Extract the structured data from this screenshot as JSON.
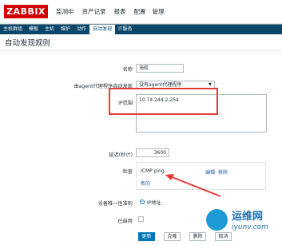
{
  "header": {
    "logo": "ZABBIX",
    "main_menu": [
      "监测中",
      "资产记录",
      "报表",
      "配置",
      "管理"
    ]
  },
  "sub_menu": [
    "主机群组",
    "模板",
    "主机",
    "维护",
    "动作",
    "自动发现",
    "IT服务"
  ],
  "page": {
    "title": "自动发现规则"
  },
  "form": {
    "name_label": "名称",
    "name_value": "海航",
    "proxy_label": "由agent代理程序自动发现",
    "proxy_value": "没有agent代理程序",
    "ip_range_label": "IP范围",
    "ip_range_value": "10.74.244.2-254",
    "delay_label": "延迟(秒计)",
    "delay_value": "3600",
    "checks_label": "检查",
    "check_type": "ICMP ping",
    "check_edit": "编辑",
    "check_remove": "移除",
    "check_new": "新的",
    "uniqueness_label": "设备唯一性准则",
    "uniqueness_value": "IP地址",
    "enabled_label": "已启用"
  },
  "buttons": {
    "update": "更新",
    "clone": "克隆",
    "delete": "删除",
    "cancel": "取消"
  },
  "watermark": {
    "line1": "运维网",
    "line2": "iyunv.com"
  }
}
